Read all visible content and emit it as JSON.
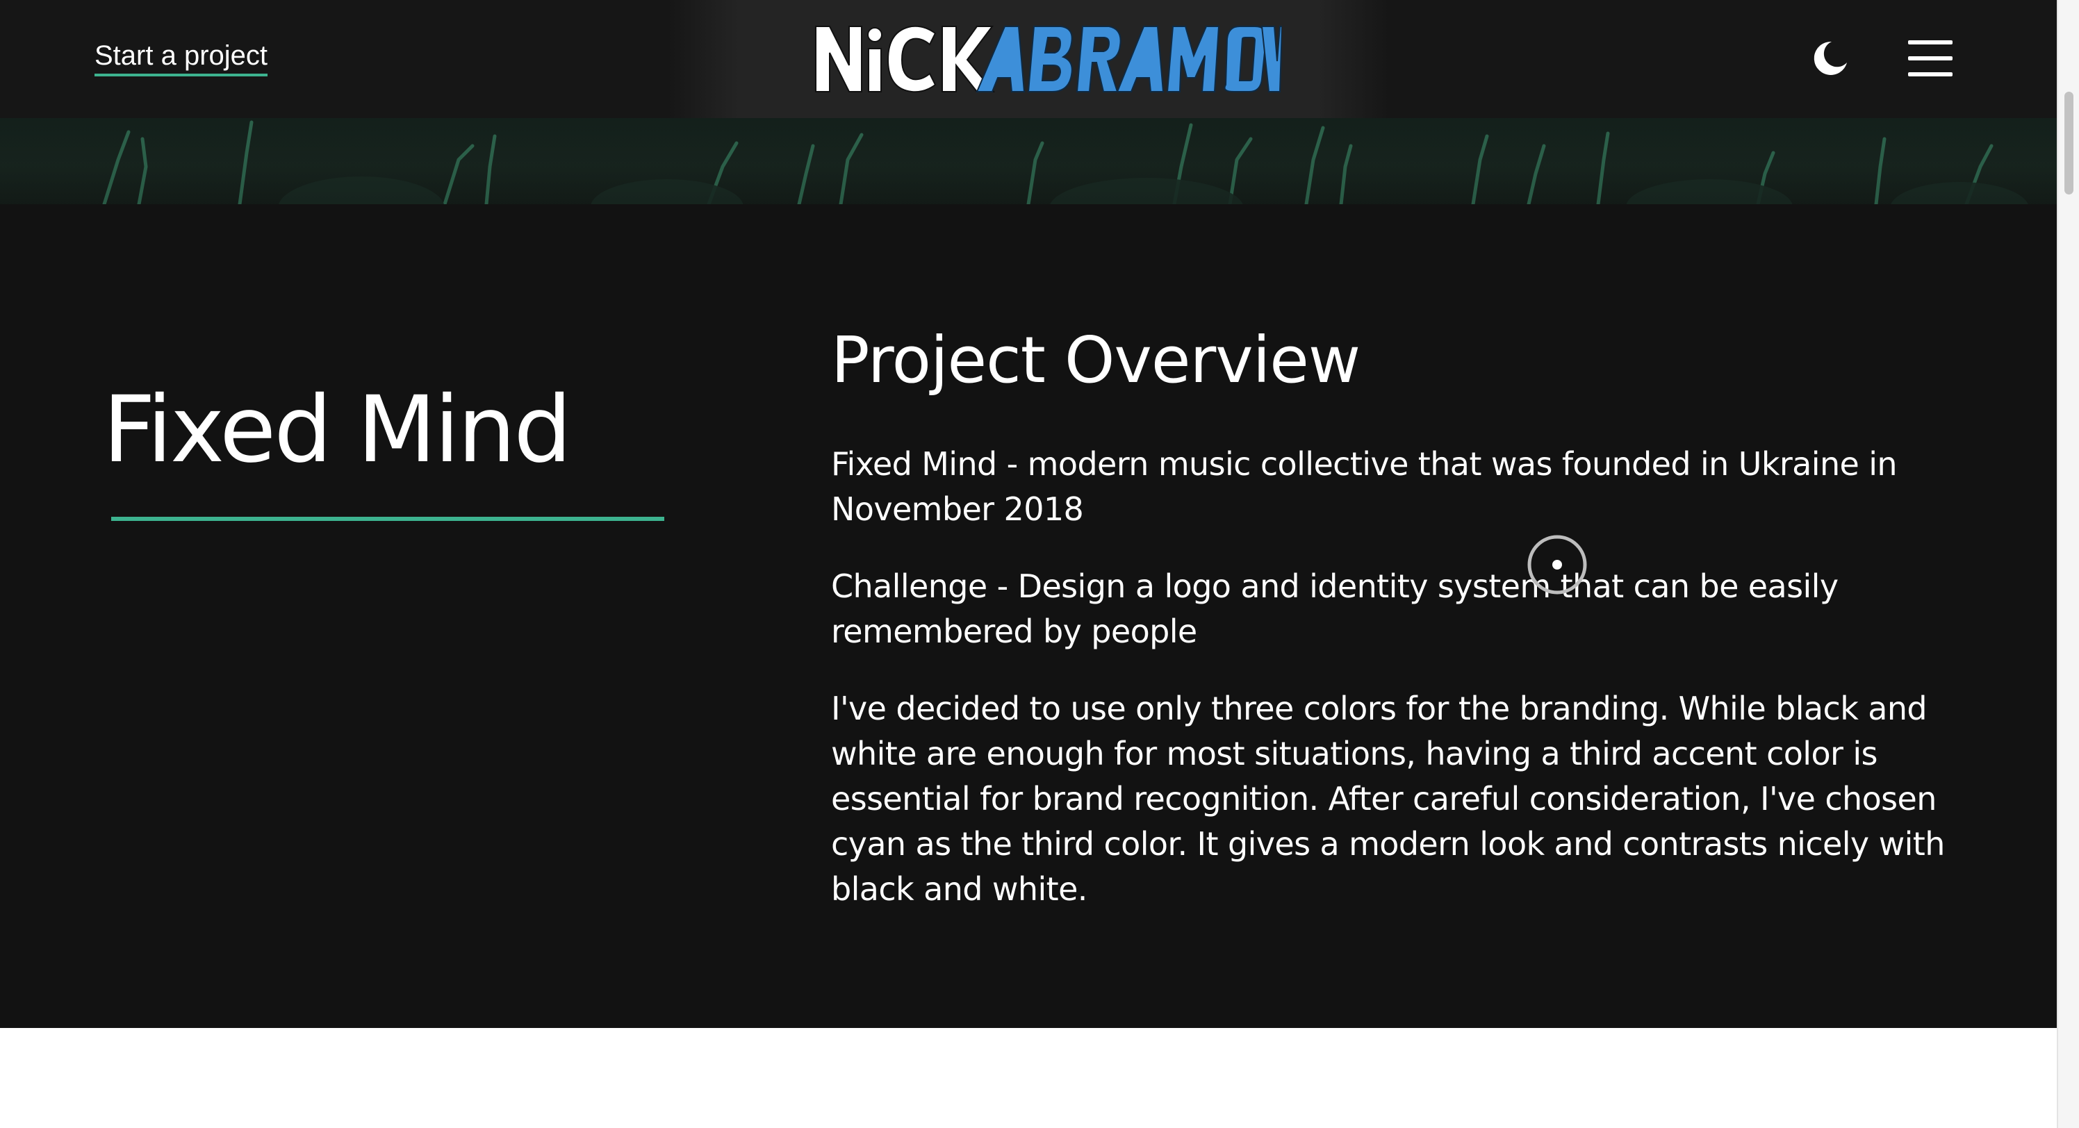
{
  "header": {
    "start_project_label": "Start a project",
    "logo_text": "NICK ABRAMOV",
    "theme_toggle_icon": "moon-icon",
    "menu_icon": "hamburger-menu-icon"
  },
  "project": {
    "title": "Fixed Mind"
  },
  "overview": {
    "heading": "Project Overview",
    "paragraphs": [
      "Fixed Mind - modern music collective that was founded in Ukraine in November 2018",
      "Challenge - Design a logo and identity system that can be easily remembered by people",
      "I've decided to use only three colors for the branding. While black and white are enough for most situations, having a third accent color is essential for brand recognition. After careful consideration, I've chosen cyan as the third color. It gives a modern look and contrasts nicely with black and white."
    ]
  },
  "colors": {
    "background": "#121212",
    "header": "#161616",
    "accent": "#3db38f",
    "logo_blue": "#3d8fd9",
    "text": "#ffffff"
  }
}
